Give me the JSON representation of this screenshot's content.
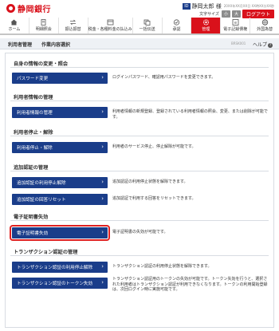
{
  "header": {
    "bank_name": "静岡銀行",
    "user_badge": "ID",
    "user_name": "静岡太郎 様",
    "last_login": "20XX年XX月XX日 XX時XX分XX秒",
    "security_link": "文字サイズ",
    "size_small": "小",
    "size_large": "大",
    "logout": "ログアウト"
  },
  "nav": [
    {
      "label": "ホーム",
      "icon": "home-icon"
    },
    {
      "label": "明細照会",
      "icon": "document-icon"
    },
    {
      "label": "振込振替",
      "icon": "transfer-icon"
    },
    {
      "label": "税金・各種料金の払込み",
      "icon": "tax-icon"
    },
    {
      "label": "一括伝送",
      "icon": "batch-icon"
    },
    {
      "label": "承認",
      "icon": "approve-icon"
    },
    {
      "label": "管理",
      "icon": "gear-icon",
      "active": true
    },
    {
      "label": "電子記録債権",
      "icon": "ledger-icon"
    },
    {
      "label": "外国為替",
      "icon": "globe-icon"
    }
  ],
  "page": {
    "crumb1": "利用者管理",
    "crumb2": "作業内容選択",
    "screen_id": "BRSK001",
    "help": "ヘルプ"
  },
  "sections": [
    {
      "title": "自身の情報の変更・照会",
      "items": [
        {
          "button": "パスワード変更",
          "desc": "ログインパスワード、確認用パスワードを変更できます。"
        }
      ]
    },
    {
      "title": "利用者情報の管理",
      "items": [
        {
          "button": "利用者情報の管理",
          "desc": "利用者情報の新規登録、登録されている利用者情報の照会、変更、または削除が可能です。"
        }
      ]
    },
    {
      "title": "利用者停止・解除",
      "items": [
        {
          "button": "利用者停止・解除",
          "desc": "利用者のサービス停止、停止解除が可能です。"
        }
      ]
    },
    {
      "title": "追加認証の管理",
      "items": [
        {
          "button": "追加認証の利用停止解除",
          "desc": "追加認証の利用停止状態を解除できます。"
        },
        {
          "button": "追加認証の回答リセット",
          "desc": "追加認証で利用する回答をリセットできます。"
        }
      ]
    },
    {
      "title": "電子証明書失効",
      "items": [
        {
          "button": "電子証明書失効",
          "desc": "電子証明書の失効が可能です。",
          "selected": true
        }
      ]
    },
    {
      "title": "トランザクション認証の管理",
      "items": [
        {
          "button": "トランザクション認証の利用停止解除",
          "desc": "トランザクション認証の利用停止状態を解除できます。"
        },
        {
          "button": "トランザクション認証のトークン失効",
          "desc": "トランザクション認証用のトークンの失効が可能です。トークン失効を行うと、選択された利用者はトランザクション認証が利用できなくなります。トークンの利用開始登録は、次回ログイン時に実施可能です。"
        }
      ]
    }
  ]
}
